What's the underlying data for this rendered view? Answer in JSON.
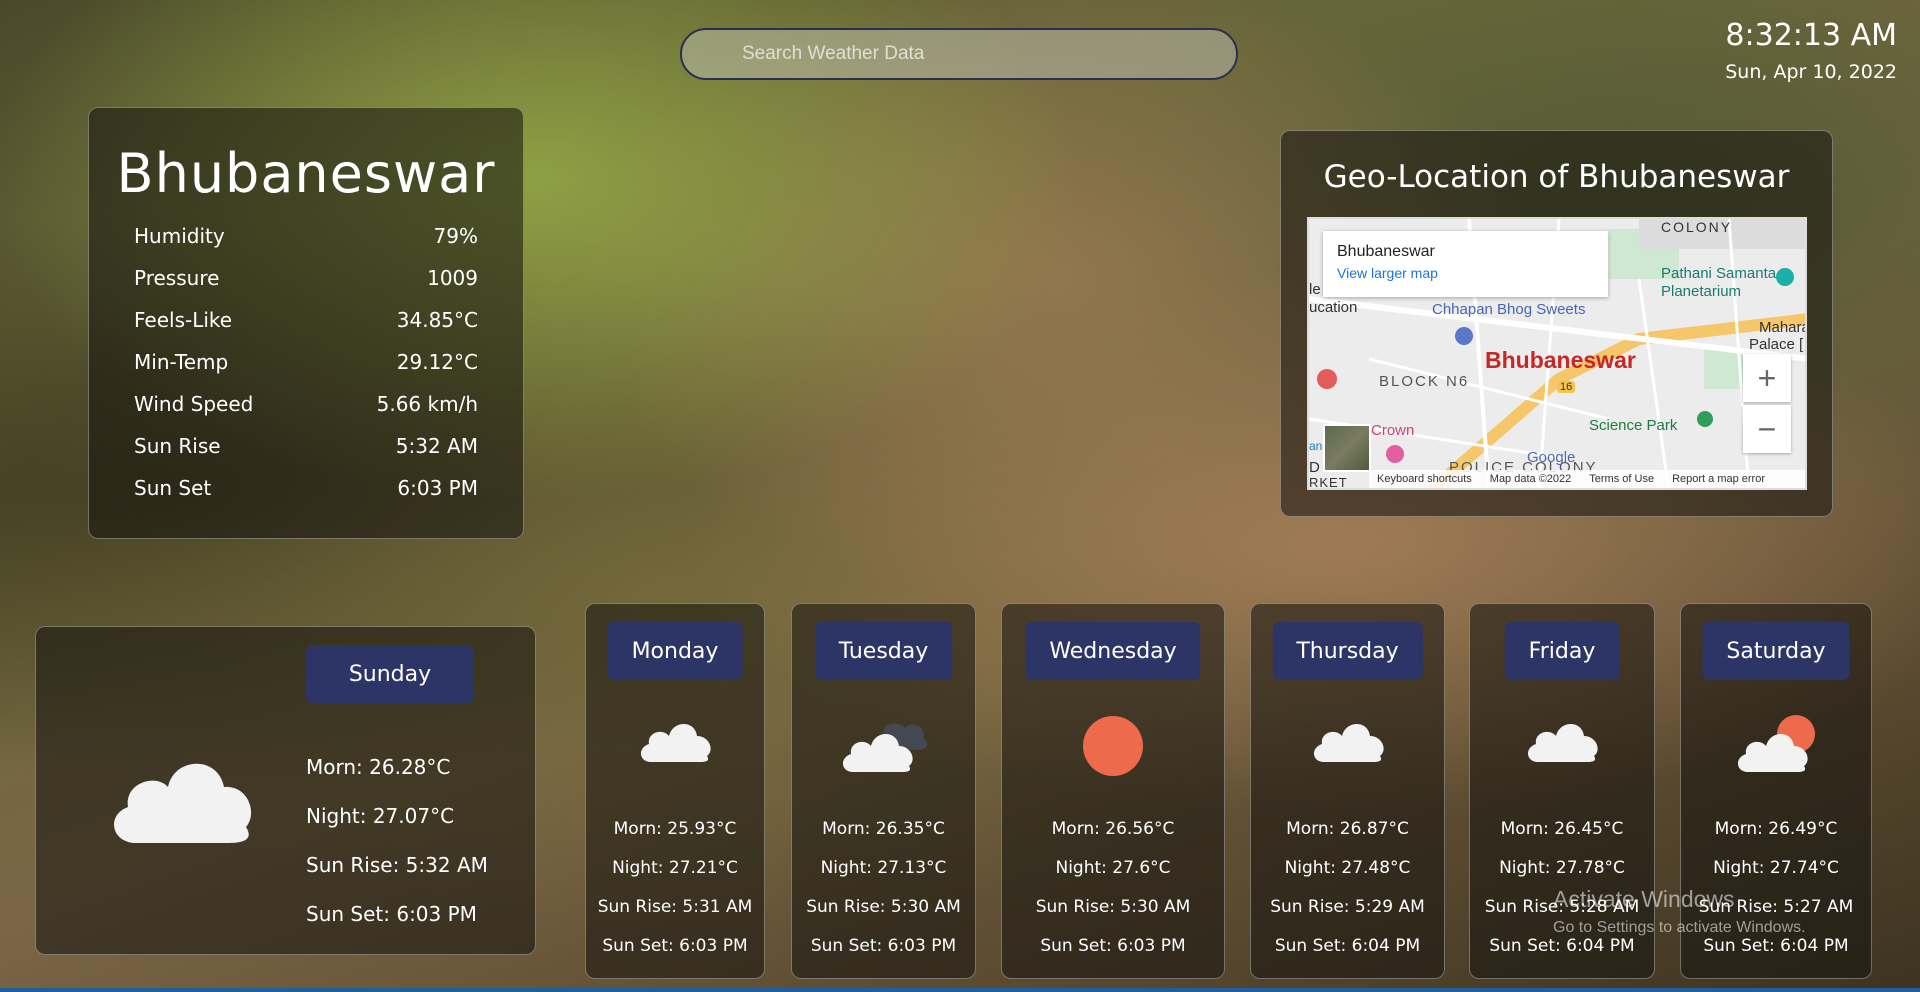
{
  "search": {
    "placeholder": "Search Weather Data"
  },
  "clock": {
    "time": "8:32:13 AM",
    "date": "Sun, Apr 10, 2022"
  },
  "city": {
    "name": "Bhubaneswar",
    "details": [
      {
        "label": "Humidity",
        "value": "79%"
      },
      {
        "label": "Pressure",
        "value": "1009"
      },
      {
        "label": "Feels-Like",
        "value": "34.85°C"
      },
      {
        "label": "Min-Temp",
        "value": "29.12°C"
      },
      {
        "label": "Wind Speed",
        "value": "5.66 km/h"
      },
      {
        "label": "Sun Rise",
        "value": "5:32 AM"
      },
      {
        "label": "Sun Set",
        "value": "6:03 PM"
      }
    ]
  },
  "map": {
    "title": "Geo-Location of Bhubaneswar",
    "popup_title": "Bhubaneswar",
    "popup_link": "View larger map",
    "city_label": "Bhubaneswar",
    "labels": [
      "COLONY",
      "Pathani Samanta",
      "Planetarium",
      "Chhapan Bhog Sweets",
      "Maharaja I",
      "Palace [ Christie",
      "BLOCK N6",
      "Science Park",
      "Crown",
      "POLICE COLONY",
      "ucation",
      "le",
      "16",
      "D",
      "RKET",
      "an"
    ],
    "zoom_in": "+",
    "zoom_out": "−",
    "footer": [
      "Keyboard shortcuts",
      "Map data ©2022",
      "Terms of Use",
      "Report a map error"
    ],
    "google": "Google"
  },
  "today": {
    "day": "Sunday",
    "morn": "Morn: 26.28°C",
    "night": "Night: 27.07°C",
    "sunrise": "Sun Rise: 5:32 AM",
    "sunset": "Sun Set: 6:03 PM",
    "icon": "cloud-icon"
  },
  "forecast": [
    {
      "day": "Monday",
      "morn": "Morn:  25.93°C",
      "night": "Night:  27.21°C",
      "sunrise": "Sun Rise: 5:31 AM",
      "sunset": "Sun Set: 6:03 PM",
      "icon": "cloud-icon"
    },
    {
      "day": "Tuesday",
      "morn": "Morn:  26.35°C",
      "night": "Night:  27.13°C",
      "sunrise": "Sun Rise: 5:30 AM",
      "sunset": "Sun Set: 6:03 PM",
      "icon": "dark-cloud-icon"
    },
    {
      "day": "Wednesday",
      "morn": "Morn:  26.56°C",
      "night": "Night:  27.6°C",
      "sunrise": "Sun Rise: 5:30 AM",
      "sunset": "Sun Set: 6:03 PM",
      "icon": "sun-icon"
    },
    {
      "day": "Thursday",
      "morn": "Morn:  26.87°C",
      "night": "Night:  27.48°C",
      "sunrise": "Sun Rise: 5:29 AM",
      "sunset": "Sun Set: 6:04 PM",
      "icon": "cloud-icon"
    },
    {
      "day": "Friday",
      "morn": "Morn:  26.45°C",
      "night": "Night:  27.78°C",
      "sunrise": "Sun Rise: 5:28 AM",
      "sunset": "Sun Set: 6:04 PM",
      "icon": "cloud-icon"
    },
    {
      "day": "Saturday",
      "morn": "Morn:  26.49°C",
      "night": "Night:  27.74°C",
      "sunrise": "Sun Rise: 5:27 AM",
      "sunset": "Sun Set: 6:04 PM",
      "icon": "sun-cloud-icon"
    }
  ],
  "watermark": {
    "title": "Activate Windows",
    "subtitle": "Go to Settings to activate Windows."
  },
  "colors": {
    "day_badge": "#2d3466",
    "sun": "#ee6a4c",
    "cloud": "#f2f2f2"
  }
}
